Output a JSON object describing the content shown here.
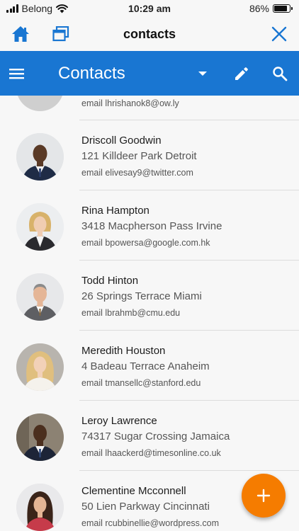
{
  "status_bar": {
    "carrier": "Belong",
    "time": "10:29 am",
    "battery_percent": "86%",
    "battery_level": 0.86
  },
  "web_header": {
    "title": "contacts",
    "icons": [
      "home-icon",
      "tabs-icon",
      "close-icon"
    ]
  },
  "app_bar": {
    "title": "Contacts",
    "icons": [
      "menu-icon",
      "dropdown-caret-icon",
      "edit-icon",
      "search-icon"
    ]
  },
  "contacts": [
    {
      "name": "",
      "address": "",
      "email": "email lhrishanok8@ow.ly",
      "avatar": "person-photo"
    },
    {
      "name": "Driscoll Goodwin",
      "address": "121 Killdeer Park Detroit",
      "email": "email elivesay9@twitter.com",
      "avatar": "person-photo"
    },
    {
      "name": "Rina Hampton",
      "address": "3418 Macpherson Pass Irvine",
      "email": "email bpowersa@google.com.hk",
      "avatar": "person-photo"
    },
    {
      "name": "Todd Hinton",
      "address": "26 Springs Terrace Miami",
      "email": "email lbrahmb@cmu.edu",
      "avatar": "person-photo"
    },
    {
      "name": "Meredith Houston",
      "address": "4 Badeau Terrace Anaheim",
      "email": "email tmansellc@stanford.edu",
      "avatar": "person-photo"
    },
    {
      "name": "Leroy Lawrence",
      "address": "74317 Sugar Crossing Jamaica",
      "email": "email lhaackerd@timesonline.co.uk",
      "avatar": "person-photo"
    },
    {
      "name": "Clementine Mcconnell",
      "address": "50 Lien Parkway Cincinnati",
      "email": "email rcubbinellie@wordpress.com",
      "avatar": "person-photo"
    }
  ],
  "fab": {
    "icon": "plus-icon"
  },
  "colors": {
    "app_bar": "#1976d2",
    "fab": "#f57c00",
    "nav_icon": "#1976d2"
  }
}
